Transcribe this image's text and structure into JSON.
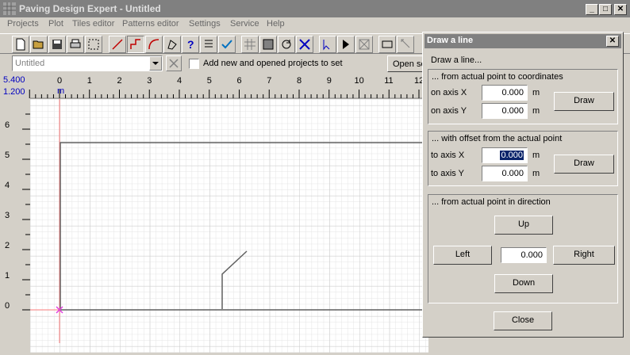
{
  "window": {
    "title": "Paving Design Expert - Untitled"
  },
  "window_controls": {
    "minimize": "_",
    "maximize": "□",
    "close": "✕"
  },
  "menu": [
    "Projects",
    "Plot",
    "Tiles editor",
    "Patterns editor",
    "Settings",
    "Service",
    "Help"
  ],
  "toolbar": {
    "icons": [
      "new-document-icon",
      "open-folder-icon",
      "save-icon",
      "print-icon",
      "select-rect-icon",
      "draw-line-icon",
      "draw-polyline-icon",
      "draw-arc-icon",
      "node-edit-icon",
      "help-icon",
      "list-icon",
      "check-icon",
      "grid-icon",
      "fill-icon",
      "rotate-icon",
      "delete-icon",
      "point-cursor-icon",
      "play-icon",
      "stop-icon",
      "rectangle-icon",
      "select-icon"
    ]
  },
  "project": {
    "combo_value": "Untitled",
    "checkbox_label": "Add new and opened projects to set",
    "checkbox_checked": false,
    "open_set_label": "Open se"
  },
  "canvas": {
    "cursor_x": "5.400",
    "cursor_y": "1.200",
    "unit": "m",
    "ruler_x": [
      "0",
      "1",
      "2",
      "3",
      "4",
      "5",
      "6",
      "7",
      "8",
      "9",
      "10",
      "11",
      "12"
    ],
    "ruler_y": [
      "6",
      "5",
      "4",
      "3",
      "2",
      "1",
      "0"
    ]
  },
  "dialog": {
    "title": "Draw a line",
    "subtitle": "Draw a line...",
    "coords": {
      "label": "... from actual point to coordinates",
      "x_label": "on axis X",
      "x_value": "0.000",
      "y_label": "on axis Y",
      "y_value": "0.000",
      "unit": "m",
      "button": "Draw"
    },
    "offset": {
      "label": "... with offset from the actual point",
      "x_label": "to axis X",
      "x_value": "0.000",
      "y_label": "to axis Y",
      "y_value": "0.000",
      "unit": "m",
      "button": "Draw"
    },
    "direction": {
      "label": "... from actual point in direction",
      "up": "Up",
      "left": "Left",
      "right": "Right",
      "down": "Down",
      "value": "0.000"
    },
    "close": "Close"
  }
}
